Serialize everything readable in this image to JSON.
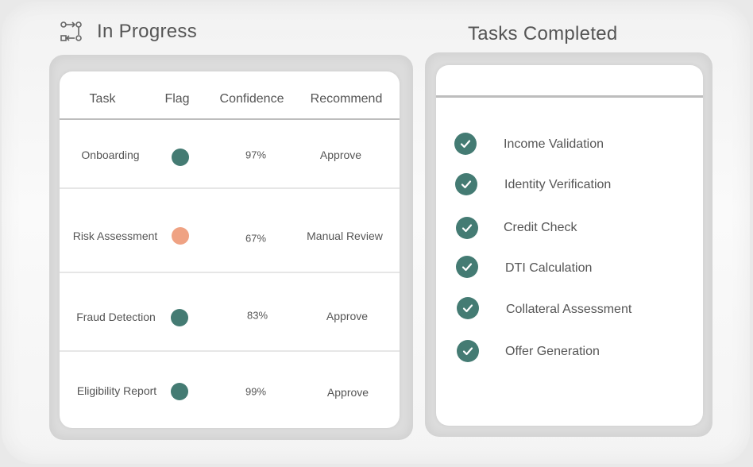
{
  "header": {
    "in_progress_title": "In Progress",
    "completed_title": "Tasks Completed",
    "workflow_icon": "workflow-icon"
  },
  "colors": {
    "teal": "#447b73",
    "orange": "#efa283"
  },
  "table": {
    "columns": [
      "Task",
      "Flag",
      "Confidence",
      "Recommend"
    ],
    "rows": [
      {
        "task": "Onboarding",
        "flag": "teal",
        "confidence": "97%",
        "recommend": "Approve"
      },
      {
        "task": "Risk Assessment",
        "flag": "orange",
        "confidence": "67%",
        "recommend": "Manual Review"
      },
      {
        "task": "Fraud Detection",
        "flag": "teal",
        "confidence": "83%",
        "recommend": "Approve"
      },
      {
        "task": "Eligibility Report",
        "flag": "teal",
        "confidence": "99%",
        "recommend": "Approve"
      }
    ]
  },
  "completed": {
    "icon": "check-circle-icon",
    "items": [
      "Income Validation",
      "Identity Verification",
      "Credit Check",
      "DTI Calculation",
      "Collateral Assessment",
      "Offer Generation"
    ]
  }
}
